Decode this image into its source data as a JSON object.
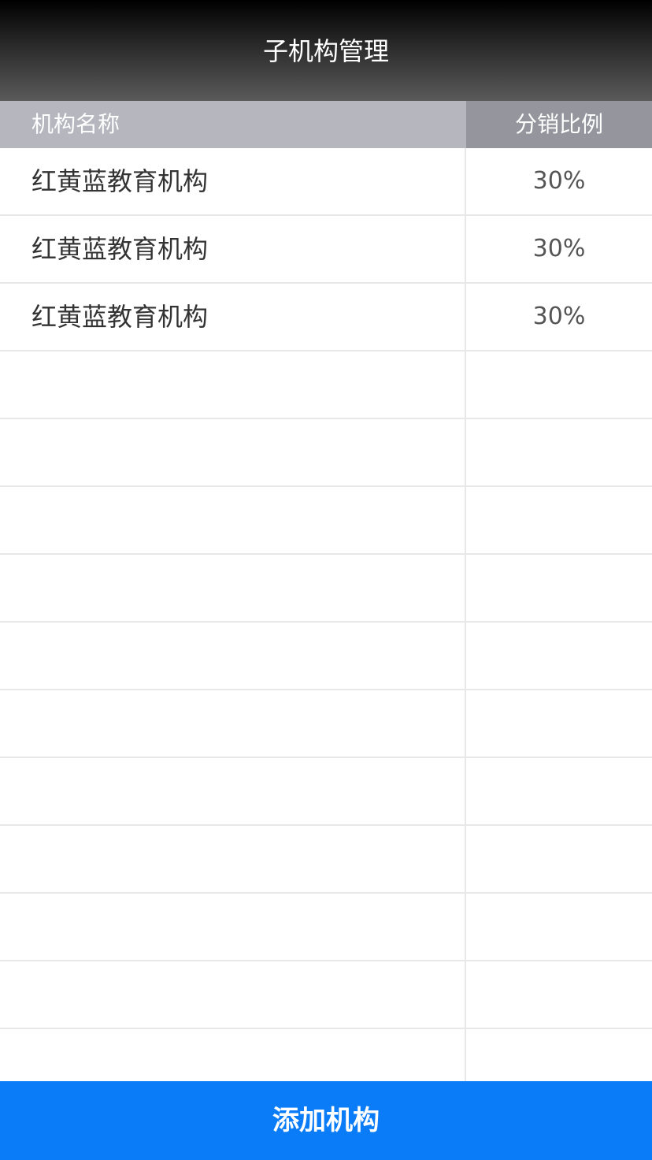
{
  "header": {
    "title": "子机构管理"
  },
  "table": {
    "columns": {
      "name": "机构名称",
      "ratio": "分销比例"
    },
    "rows": [
      {
        "name": "红黄蓝教育机构",
        "ratio": "30%"
      },
      {
        "name": "红黄蓝教育机构",
        "ratio": "30%"
      },
      {
        "name": "红黄蓝教育机构",
        "ratio": "30%"
      },
      {
        "name": "",
        "ratio": ""
      },
      {
        "name": "",
        "ratio": ""
      },
      {
        "name": "",
        "ratio": ""
      },
      {
        "name": "",
        "ratio": ""
      },
      {
        "name": "",
        "ratio": ""
      },
      {
        "name": "",
        "ratio": ""
      },
      {
        "name": "",
        "ratio": ""
      },
      {
        "name": "",
        "ratio": ""
      },
      {
        "name": "",
        "ratio": ""
      },
      {
        "name": "",
        "ratio": ""
      },
      {
        "name": "",
        "ratio": ""
      }
    ]
  },
  "footer": {
    "add_label": "添加机构"
  },
  "colors": {
    "accent": "#0a7cf7",
    "header_name_bg": "#b5b6be",
    "header_ratio_bg": "#95969d"
  }
}
